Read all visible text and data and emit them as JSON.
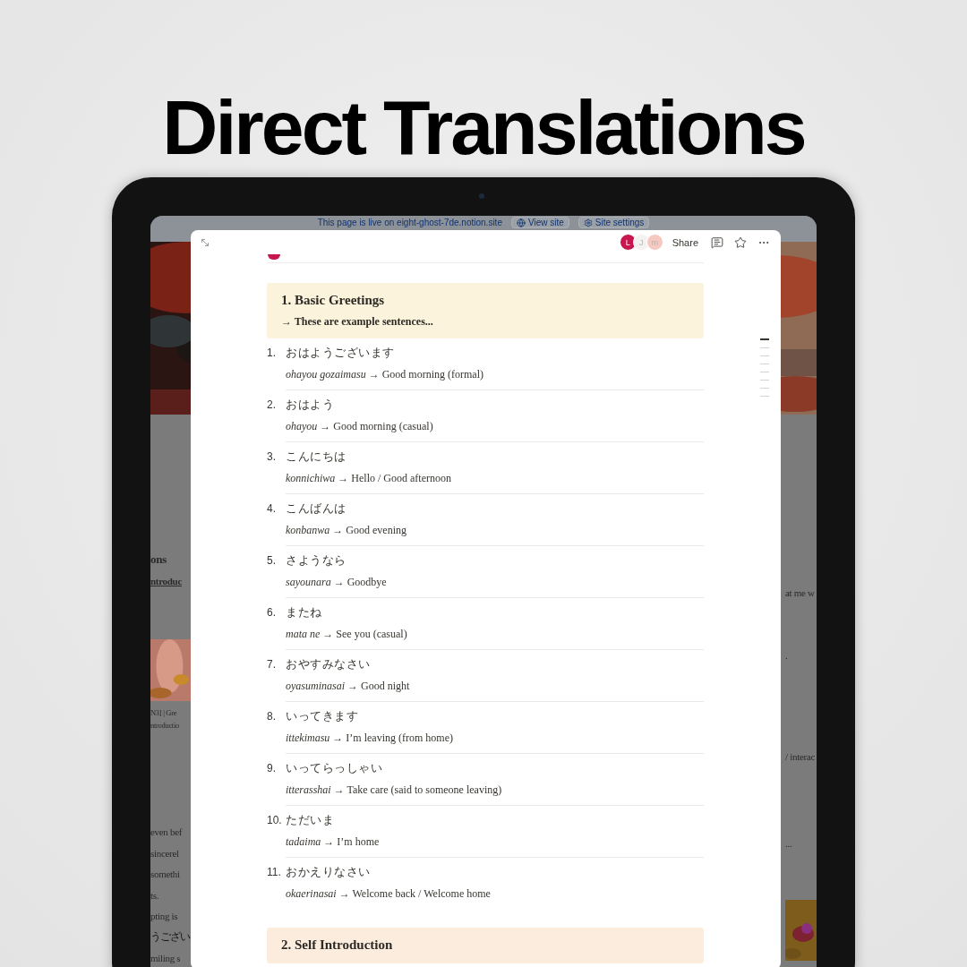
{
  "headline": "Direct Translations",
  "background_page": {
    "banner": {
      "text": "This page is live on eight-ghost-7de.notion.site",
      "buttons": [
        {
          "kind": "globe",
          "label": "View site"
        },
        {
          "kind": "gear",
          "label": "Site settings"
        }
      ]
    },
    "left_fragments": [
      {
        "kind": "heading",
        "text": "ons"
      },
      {
        "kind": "link",
        "text": "ntroduc"
      },
      {
        "kind": "picture"
      },
      {
        "kind": "caption",
        "text": "N3] | Gre"
      },
      {
        "kind": "caption",
        "text": "ntroductio"
      },
      {
        "kind": "text",
        "text": "even bef"
      },
      {
        "kind": "text",
        "text": "sincerel"
      },
      {
        "kind": "text",
        "text": "somethi"
      },
      {
        "kind": "text",
        "text": "ts."
      },
      {
        "kind": "text",
        "text": "pting is"
      },
      {
        "kind": "text",
        "text": "うござい"
      },
      {
        "kind": "text",
        "text": "miling s"
      }
    ],
    "right_fragments": [
      {
        "kind": "text",
        "text": "at me w"
      },
      {
        "kind": "text",
        "text": "."
      },
      {
        "kind": "text",
        "text": "/ interac"
      },
      {
        "kind": "text",
        "text": "..."
      },
      {
        "kind": "picture"
      }
    ]
  },
  "modal": {
    "avatars": [
      {
        "letter": "L",
        "color": "#c8174f"
      },
      {
        "letter": "J",
        "color": "#f4f1f1"
      },
      {
        "letter": "m",
        "color": "#f6c9c0"
      }
    ],
    "share": "Share",
    "toc_marks": [
      {
        "selected": true
      },
      {
        "selected": false
      },
      {
        "selected": false
      },
      {
        "selected": false
      },
      {
        "selected": false
      },
      {
        "selected": false
      },
      {
        "selected": false
      },
      {
        "selected": false
      }
    ],
    "sections": [
      {
        "title": "1. Basic Greetings",
        "subtitle": "→ These are example sentences...",
        "color": "#fbf3db",
        "items": [
          {
            "number": "1.",
            "japanese": "おはようございます",
            "translation": "*ohayou gozaimasu* → Good morning (formal)"
          },
          {
            "number": "2.",
            "japanese": "おはよう",
            "translation": "*ohayou* → Good morning (casual)"
          },
          {
            "number": "3.",
            "japanese": "こんにちは",
            "translation": "*konnichiwa* → Hello / Good afternoon"
          },
          {
            "number": "4.",
            "japanese": "こんばんは",
            "translation": "*konbanwa* → Good evening"
          },
          {
            "number": "5.",
            "japanese": "さようなら",
            "translation": "*sayounara* → Goodbye"
          },
          {
            "number": "6.",
            "japanese": "またね",
            "translation": "*mata ne* → See you (casual)"
          },
          {
            "number": "7.",
            "japanese": "おやすみなさい",
            "translation": "*oyasuminasai* → Good night"
          },
          {
            "number": "8.",
            "japanese": "いってきます",
            "translation": "*ittekimasu* → I’m leaving (from home)"
          },
          {
            "number": "9.",
            "japanese": "いってらっしゃい",
            "translation": "*itterasshai* → Take care (said to someone leaving)"
          },
          {
            "number": "10.",
            "japanese": "ただいま",
            "translation": "*tadaima* → I’m home"
          },
          {
            "number": "11.",
            "japanese": "おかえりなさい",
            "translation": "*okaerinasai* → Welcome back / Welcome home"
          }
        ]
      },
      {
        "title": "2. Self Introduction",
        "color": "#fbecdd"
      }
    ]
  }
}
